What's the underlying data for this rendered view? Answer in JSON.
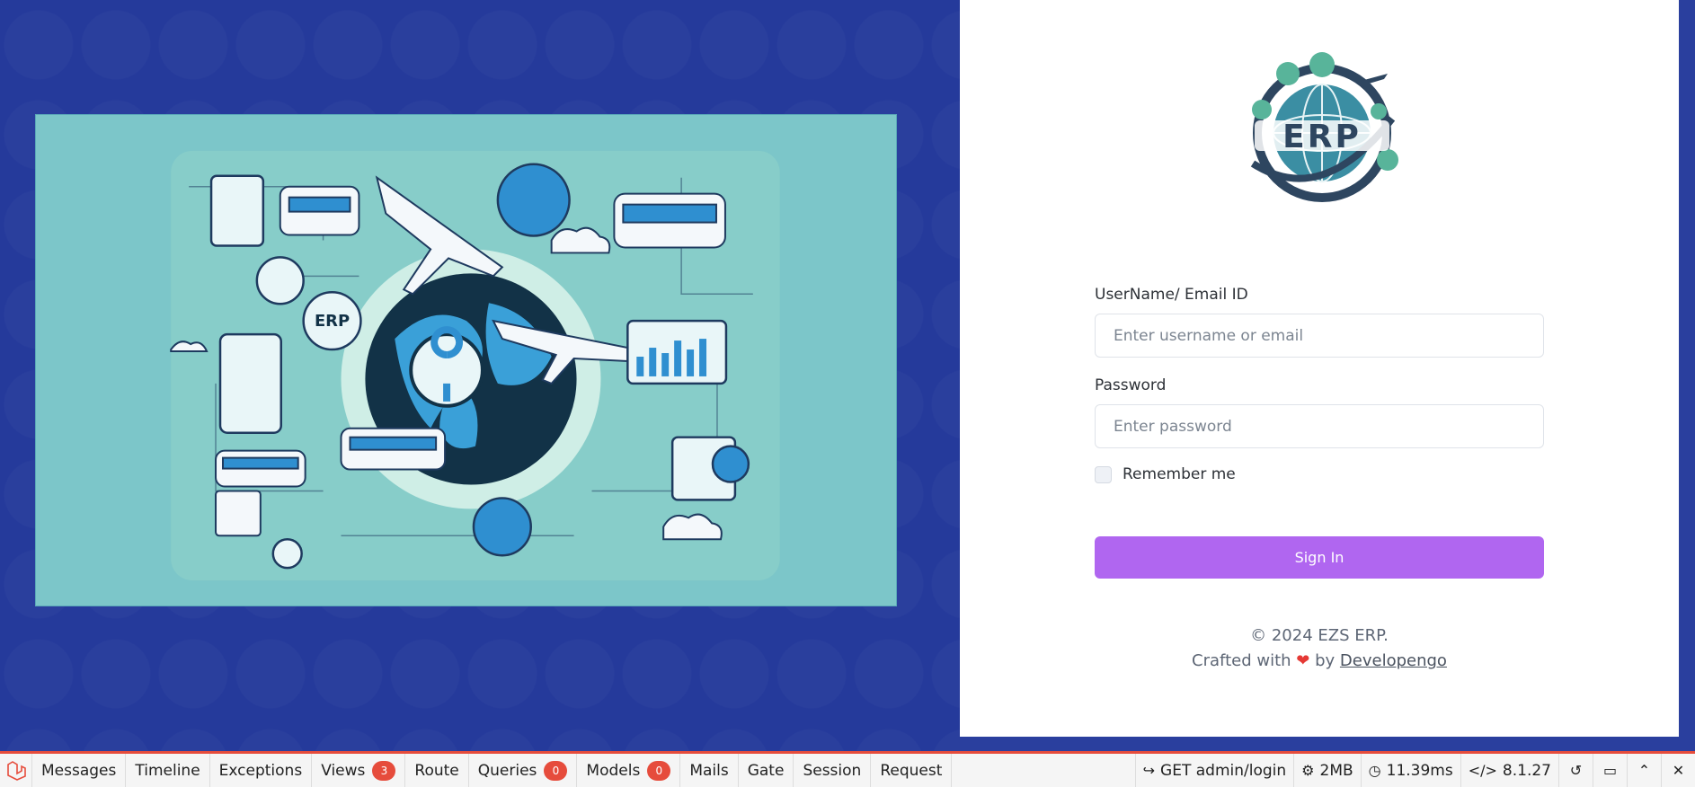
{
  "login": {
    "username_label": "UserName/ Email ID",
    "username_placeholder": "Enter username or email",
    "password_label": "Password",
    "password_placeholder": "Enter password",
    "remember_label": "Remember me",
    "signin_label": "Sign In"
  },
  "logo": {
    "text": "ERP"
  },
  "footer": {
    "copyright": "© 2024 EZS ERP.",
    "crafted_prefix": "Crafted with",
    "heart": "❤",
    "by": "by",
    "developer": "Developengo"
  },
  "colors": {
    "background": "#253a9b",
    "accent": "#b066f0",
    "debugbar_accent": "#e64c3c"
  },
  "debugbar": {
    "tabs": [
      {
        "label": "Messages"
      },
      {
        "label": "Timeline"
      },
      {
        "label": "Exceptions"
      },
      {
        "label": "Views",
        "badge": "3"
      },
      {
        "label": "Route"
      },
      {
        "label": "Queries",
        "badge": "0"
      },
      {
        "label": "Models",
        "badge": "0"
      },
      {
        "label": "Mails"
      },
      {
        "label": "Gate"
      },
      {
        "label": "Session"
      },
      {
        "label": "Request"
      }
    ],
    "route": "GET admin/login",
    "memory": "2MB",
    "time": "11.39ms",
    "php_version": "8.1.27",
    "icons": [
      "share-icon",
      "cogs-icon",
      "clock-icon",
      "code-icon",
      "history-icon",
      "folder-open-icon",
      "chevron-up-icon",
      "close-icon"
    ]
  }
}
